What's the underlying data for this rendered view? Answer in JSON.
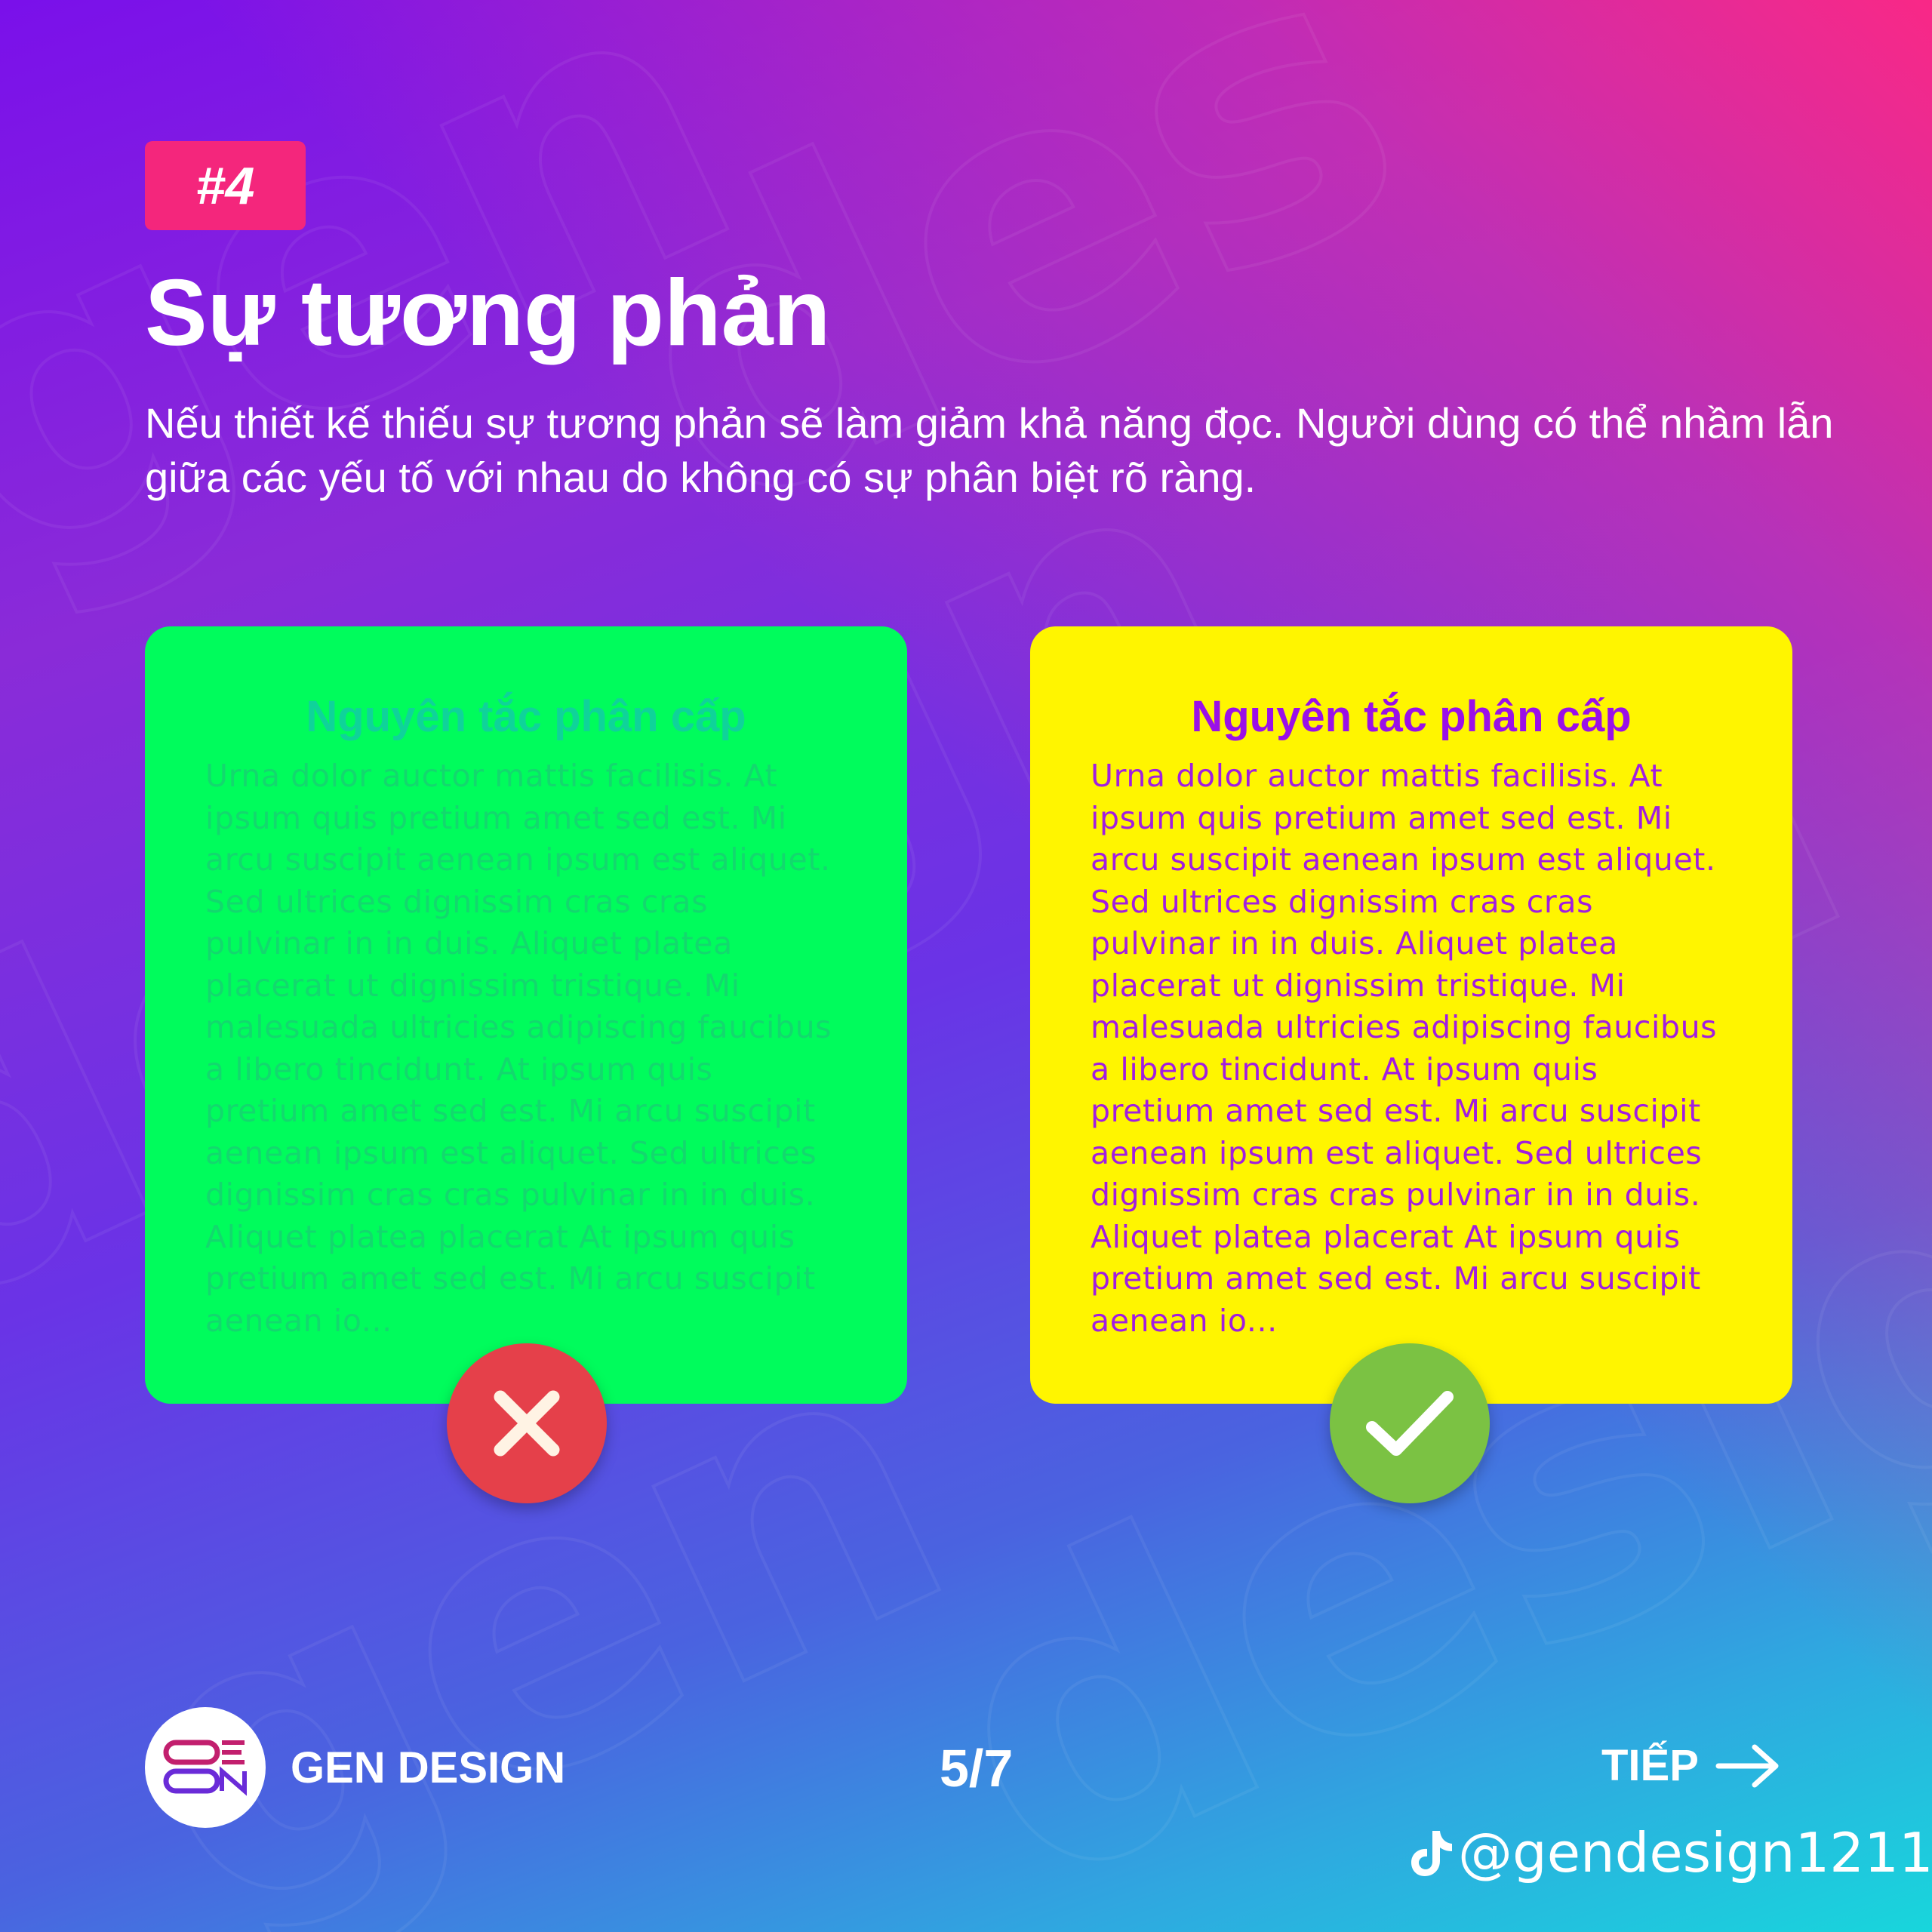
{
  "badge": {
    "label": "#4"
  },
  "header": {
    "title": "Sự tương phản",
    "subtitle": "Nếu thiết kế thiếu sự tương phản sẽ làm giảm khả năng đọc. Người dùng có thể nhầm lẫn giữa các yếu tố với nhau do không có sự phân biệt rõ ràng."
  },
  "cards": {
    "bad": {
      "title": "Nguyên tắc phân cấp",
      "body": "Urna dolor auctor mattis facilisis. At ipsum quis pretium amet sed est. Mi arcu suscipit aenean ipsum est aliquet. Sed ultrices dignissim cras cras pulvinar in in duis. Aliquet platea placerat ut dignissim tristique. Mi malesuada ultricies adipiscing faucibus a libero tincidunt. At ipsum quis pretium amet sed est. Mi arcu suscipit aenean ipsum est aliquet. Sed ultrices dignissim cras cras pulvinar in in duis. Aliquet platea placerat At ipsum quis pretium amet sed est. Mi arcu suscipit aenean io...",
      "icon": "x-icon",
      "background": "#00fc5c",
      "text_color": "#13d86e"
    },
    "good": {
      "title": "Nguyên tắc phân cấp",
      "body": "Urna dolor auctor mattis facilisis. At ipsum quis pretium amet sed est. Mi arcu suscipit aenean ipsum est aliquet. Sed ultrices dignissim cras cras pulvinar in in duis. Aliquet platea placerat ut dignissim tristique. Mi malesuada ultricies adipiscing faucibus a libero tincidunt. At ipsum quis pretium amet sed est. Mi arcu suscipit aenean ipsum est aliquet. Sed ultrices dignissim cras cras pulvinar in in duis. Aliquet platea placerat At ipsum quis pretium amet sed est. Mi arcu suscipit aenean io...",
      "icon": "check-icon",
      "background": "#fff500",
      "text_color": "#a11ee0"
    }
  },
  "footer": {
    "brand": "GEN DESIGN",
    "logo_icon": "gen-design-logo-icon",
    "page": "5/7",
    "next_label": "TIẾP",
    "next_icon": "arrow-right-icon",
    "handle": "@gendesign1211",
    "social_icon": "tiktok-icon"
  },
  "colors": {
    "badge": "#f4267c",
    "gradient_top_left": "#7a10ea",
    "gradient_top_right": "#ff2882",
    "gradient_bottom_right": "#18d6dc",
    "wrong": "#e5404a",
    "right": "#7bc243"
  }
}
